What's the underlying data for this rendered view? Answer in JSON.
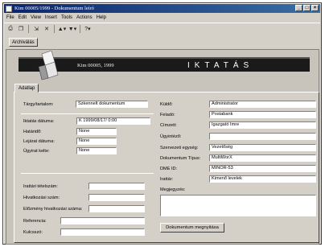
{
  "window": {
    "title": "Kim 00005/1999 - Dokumentum leíró"
  },
  "menu": [
    "File",
    "Edit",
    "View",
    "Insert",
    "Tools",
    "Actions",
    "Help"
  ],
  "archive_tab": "Archiválás",
  "banner": {
    "subtitle": "Kim 00005, 1999",
    "title": "IKTATÁS"
  },
  "tab": "Adatlap",
  "left": {
    "subject_label": "Tárgy/tartalom:",
    "subject_value": "Szkennelt dokumentum",
    "date_label": "Iktatás dátuma:",
    "date_value": "K 1999/08/17/ 0:00",
    "deadline_label": "Határidő:",
    "deadline_value": "None",
    "expiry_label": "Lejárat dátuma:",
    "expiry_value": "None",
    "casetype_label": "Ügyirat kelte:",
    "casetype_value": "None",
    "archive_item_label": "Irattári tételszám:",
    "ref_no_label": "Hivatkozási szám:",
    "prev_ref_label": "Előzmény hivatkozási száma:",
    "reference_label": "Referencia:",
    "sender_id_label": "Kulcsszó:"
  },
  "right": {
    "from_label": "Küldő:",
    "from_value": "Administrator",
    "sender_label": "Feladó:",
    "sender_value": "Postabank",
    "addressee_label": "Címzett:",
    "addressee_value": "Igazgató Imre",
    "clerk_label": "Ügyintéző:",
    "clerk_value": "",
    "org_label": "Szervezeti egység:",
    "org_value": "Vezetőség",
    "doctype_label": "Dokumentum Típus:",
    "doctype_value": "MultiWorX",
    "dme_label": "DME ID:",
    "dme_value": "MINOR-53",
    "registry_label": "Irattár:",
    "registry_value": "Kimenő levelek",
    "note_label": "Megjegyzés:",
    "note_value": ""
  },
  "open_button": "Dokumentum megnyitása"
}
